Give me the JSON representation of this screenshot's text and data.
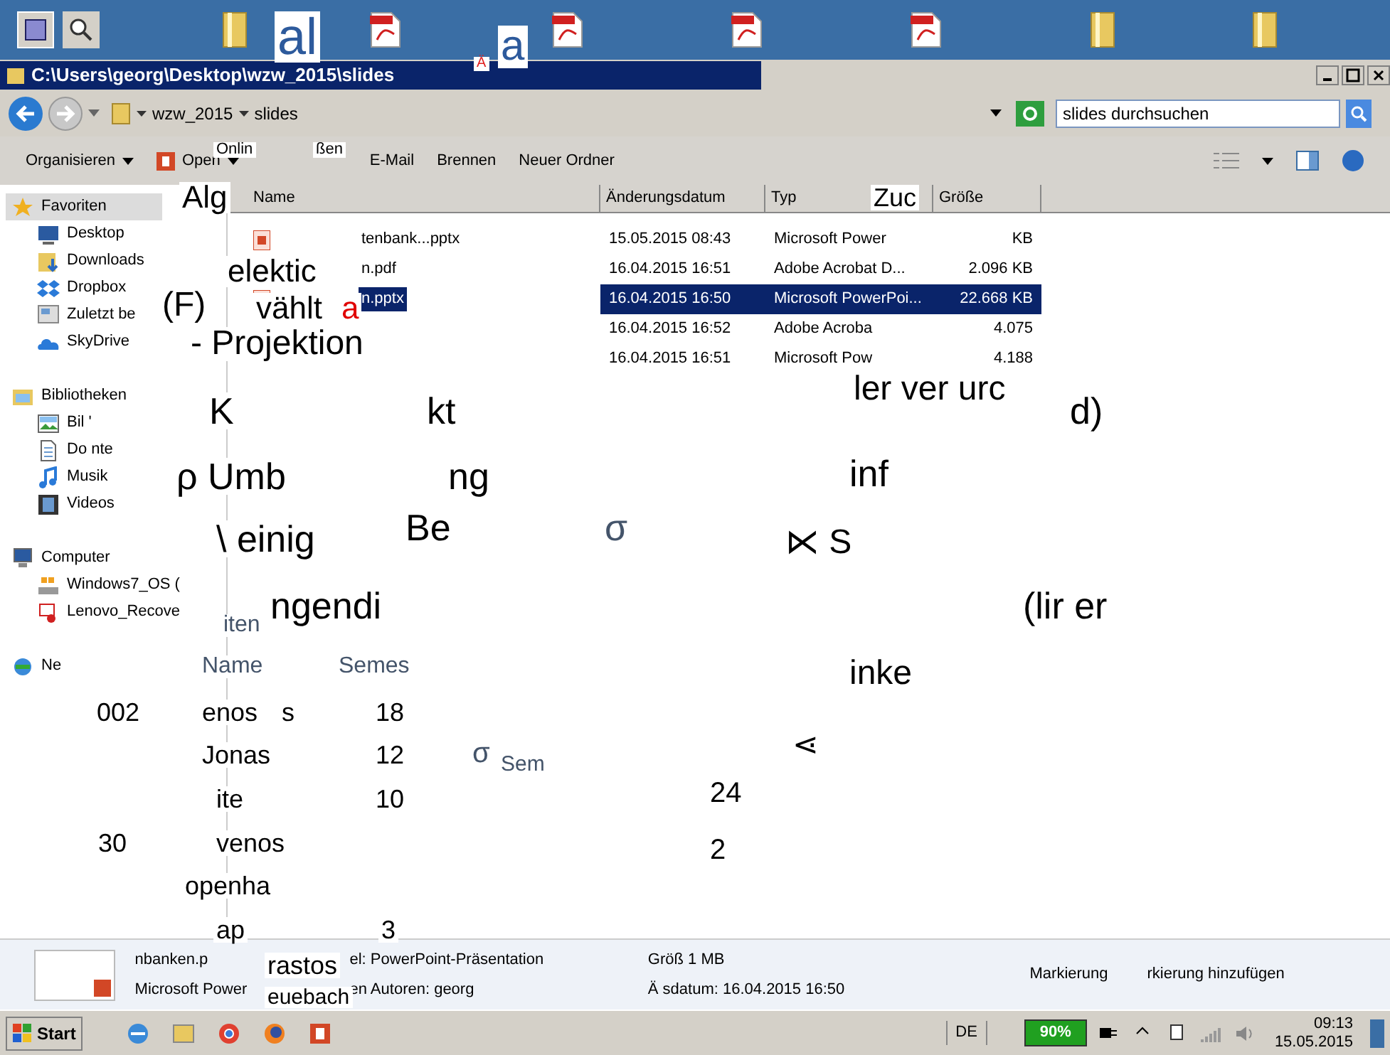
{
  "window": {
    "title": "C:\\Users\\georg\\Desktop\\wzw_2015\\slides"
  },
  "address": {
    "crumbs": [
      "wzw_2015",
      "slides"
    ],
    "search_placeholder": "slides durchsuchen"
  },
  "toolbar": [
    {
      "label": "Organisieren",
      "dropdown": true
    },
    {
      "label": "Open",
      "dropdown": true
    },
    {
      "label": "E-Mail",
      "dropdown": false
    },
    {
      "label": "Brennen",
      "dropdown": false
    },
    {
      "label": "Neuer Ordner",
      "dropdown": false
    }
  ],
  "nav": [
    {
      "label": "Favoriten",
      "kind": "star",
      "children": [
        {
          "label": "Desktop",
          "kind": "desktop"
        },
        {
          "label": "Downloads",
          "kind": "downloads"
        },
        {
          "label": "Dropbox",
          "kind": "dropbox"
        },
        {
          "label": "Zuletzt be",
          "kind": "recent"
        },
        {
          "label": "SkyDrive",
          "kind": "cloud"
        }
      ]
    },
    {
      "label": "Bibliotheken",
      "kind": "library",
      "children": [
        {
          "label": "Bil '",
          "kind": "pictures"
        },
        {
          "label": "Do          nte",
          "kind": "documents"
        },
        {
          "label": "Musik",
          "kind": "music"
        },
        {
          "label": "Videos",
          "kind": "videos"
        }
      ]
    },
    {
      "label": "Computer",
      "kind": "computer",
      "children": [
        {
          "label": "Windows7_OS (",
          "kind": "drive"
        },
        {
          "label": "Lenovo_Recove",
          "kind": "recovery"
        }
      ]
    },
    {
      "label": "Ne",
      "kind": "network"
    }
  ],
  "columns": [
    "Name",
    "Änderungsdatum",
    "Typ",
    "Größe"
  ],
  "files": [
    {
      "name": "tenbank...pptx",
      "kind": "pptx",
      "date": "15.05.2015 08:43",
      "type": "Microsoft Power",
      "size": "KB",
      "selected": false
    },
    {
      "name": "n.pdf",
      "kind": "pdf",
      "date": "16.04.2015 16:51",
      "type": "Adobe Acrobat D...",
      "size": "2.096 KB",
      "selected": false
    },
    {
      "name": "n.pptx",
      "kind": "pptx",
      "date": "16.04.2015 16:50",
      "type": "Microsoft PowerPoi...",
      "size": "22.668 KB",
      "selected": true
    },
    {
      "date": "16.04.2015 16:52",
      "type": "Adobe Acroba",
      "size": "4.075",
      "selected": false
    },
    {
      "date": "16.04.2015 16:51",
      "type": "Microsoft Pow",
      "size": "4.188",
      "selected": false
    }
  ],
  "details": {
    "name": "nbanken.p",
    "type": "Microsoft Power",
    "kind_label": "el: PowerPoint-Präsentation",
    "authors": "en Autoren: georg",
    "size": "Größ      1 MB",
    "modified": "Ä           sdatum: 16.04.2015 16:50",
    "tags": "Markierung",
    "tags_hint": "rkierung hinzufügen"
  },
  "fragments": [
    {
      "text": "al",
      "color": "#2d5a9c"
    },
    {
      "text": "Ä",
      "color": "#e02020"
    },
    {
      "text": "a",
      "color": "#2d5a9c"
    },
    {
      "text": "Onlin",
      "color": "#000000"
    },
    {
      "text": "ßen",
      "color": "#000000"
    },
    {
      "text": "Alg",
      "color": "#000000"
    },
    {
      "text": "Zuc",
      "color": "#000000"
    },
    {
      "text": "elektic",
      "color": "#000000"
    },
    {
      "text": "(F)",
      "color": "#000000"
    },
    {
      "text": "vählt",
      "color": "#000000"
    },
    {
      "text": "a",
      "color": "#e00000"
    },
    {
      "text": "- Projektion",
      "color": "#000000"
    },
    {
      "text": "ler  ver  urc",
      "color": "#000000"
    },
    {
      "text": "K",
      "color": "#000000"
    },
    {
      "text": "kt",
      "color": "#000000"
    },
    {
      "text": "d)",
      "color": "#000000"
    },
    {
      "text": "ρ Umb",
      "color": "#000000"
    },
    {
      "text": "ng",
      "color": "#000000"
    },
    {
      "text": "inf",
      "color": "#000000"
    },
    {
      "text": "\\  einig",
      "color": "#000000"
    },
    {
      "text": "Be",
      "color": "#000000"
    },
    {
      "text": "σ",
      "color": "#44546a"
    },
    {
      "text": "⋉ S",
      "color": "#000000"
    },
    {
      "text": "ngendi",
      "color": "#000000"
    },
    {
      "text": "(lir  er",
      "color": "#000000"
    },
    {
      "text": "inke",
      "color": "#000000"
    },
    {
      "text": "⋖",
      "color": "#000000"
    },
    {
      "text": "σ",
      "color": "#44546a"
    },
    {
      "text": "Sem",
      "color": "#44546a"
    },
    {
      "text": "24",
      "color": "#000000"
    },
    {
      "text": "2",
      "color": "#000000"
    },
    {
      "text": "iten",
      "color": "#44546a"
    },
    {
      "text": "Name",
      "color": "#44546a"
    },
    {
      "text": "Semes",
      "color": "#44546a"
    },
    {
      "text": "002",
      "color": "#000000"
    },
    {
      "text": "enos",
      "color": "#000000"
    },
    {
      "text": "s",
      "color": "#000000"
    },
    {
      "text": "18",
      "color": "#000000"
    },
    {
      "text": "Jonas",
      "color": "#000000"
    },
    {
      "text": "12",
      "color": "#000000"
    },
    {
      "text": "ite",
      "color": "#000000"
    },
    {
      "text": "10",
      "color": "#000000"
    },
    {
      "text": "30",
      "color": "#000000"
    },
    {
      "text": "venos",
      "color": "#000000"
    },
    {
      "text": "openha",
      "color": "#000000"
    },
    {
      "text": "ap",
      "color": "#000000"
    },
    {
      "text": "3",
      "color": "#000000"
    },
    {
      "text": "rastos",
      "color": "#000000"
    },
    {
      "text": "euebach",
      "color": "#000000"
    }
  ],
  "taskbar": {
    "start": "Start",
    "language": "DE",
    "battery": "90%",
    "time": "09:13",
    "date": "15.05.2015"
  }
}
